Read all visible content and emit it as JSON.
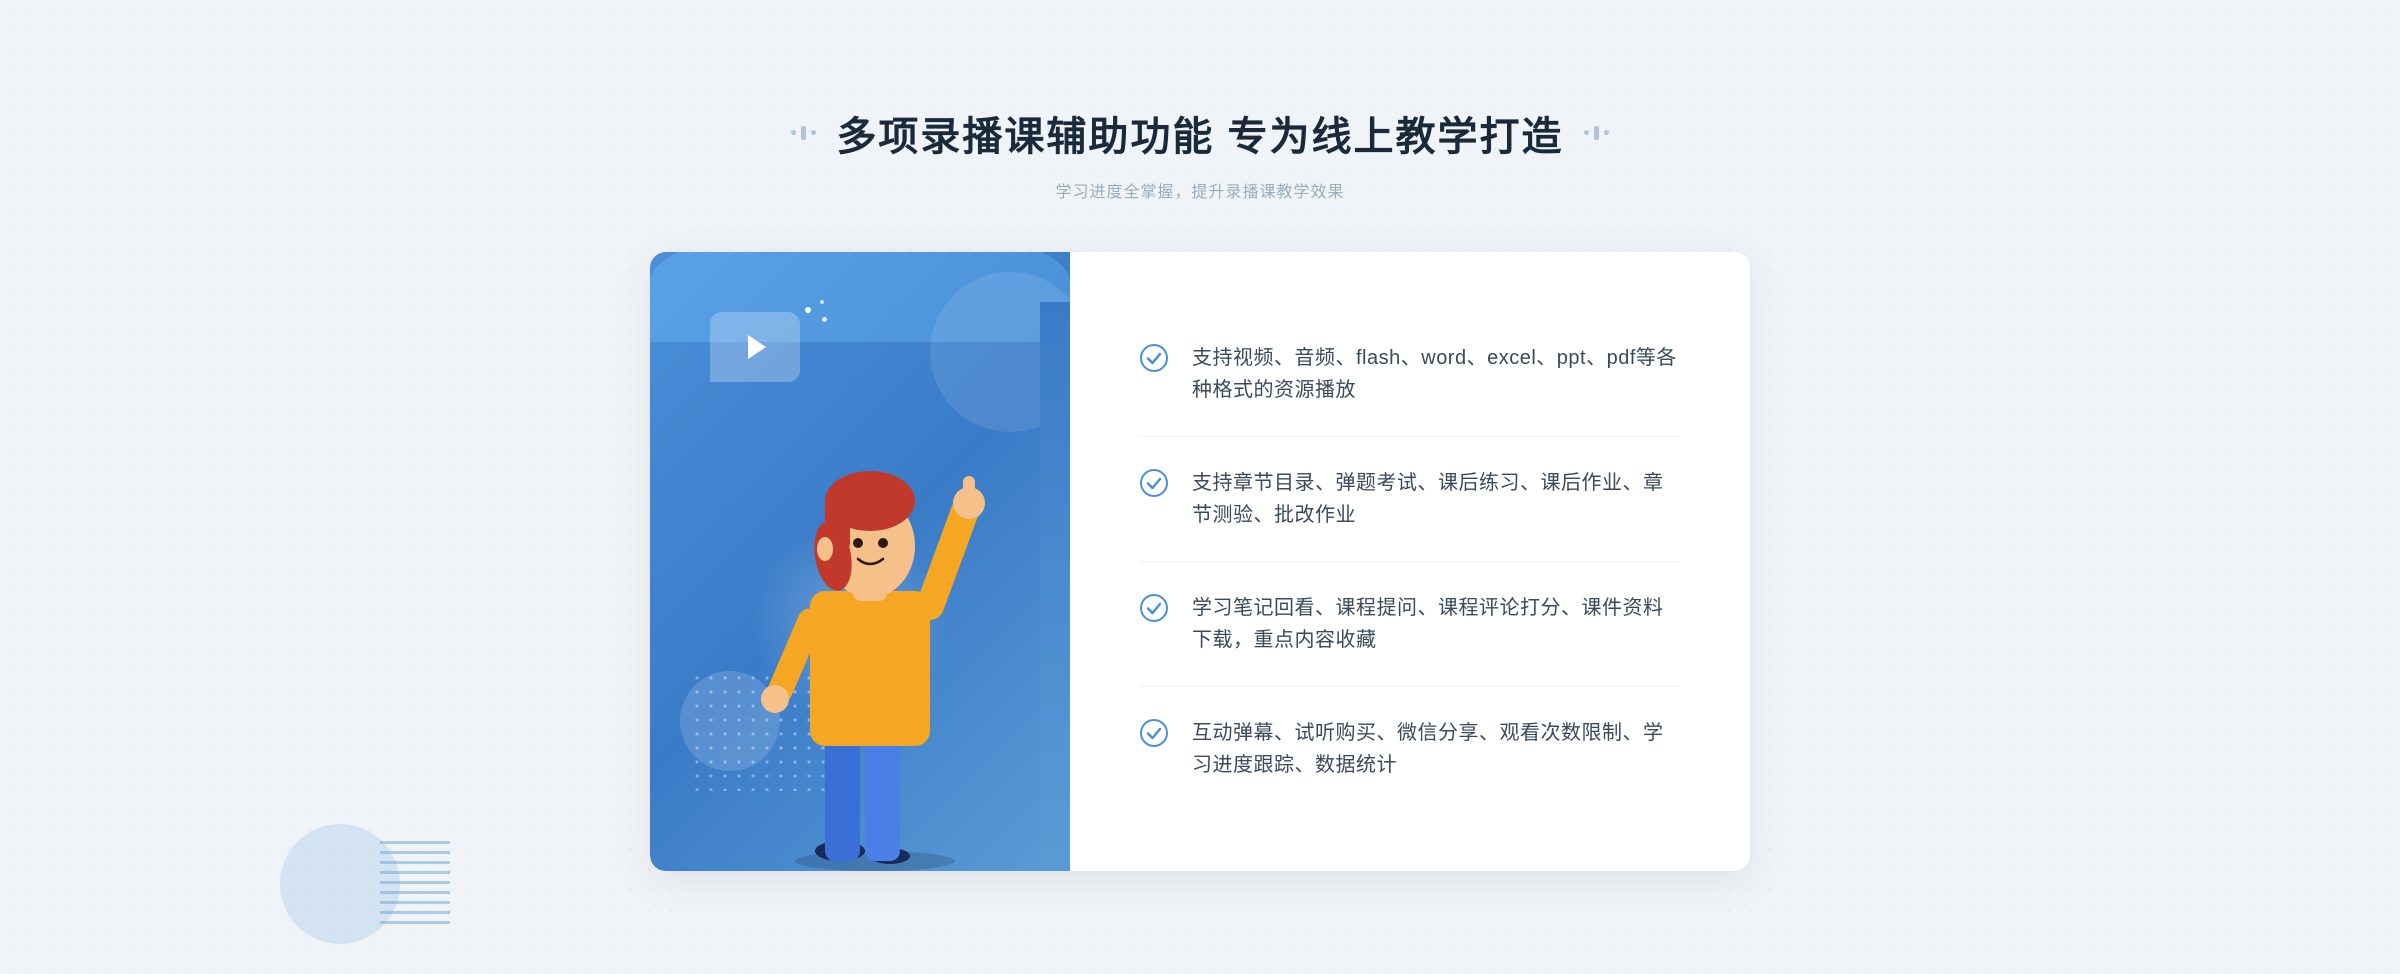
{
  "header": {
    "title": "多项录播课辅助功能 专为线上教学打造",
    "subtitle": "学习进度全掌握，提升录播课教学效果",
    "decoration_left": "❖",
    "decoration_right": "❖"
  },
  "features": [
    {
      "id": "feature-1",
      "text": "支持视频、音频、flash、word、excel、ppt、pdf等各种格式的资源播放"
    },
    {
      "id": "feature-2",
      "text": "支持章节目录、弹题考试、课后练习、课后作业、章节测验、批改作业"
    },
    {
      "id": "feature-3",
      "text": "学习笔记回看、课程提问、课程评论打分、课件资料下载，重点内容收藏"
    },
    {
      "id": "feature-4",
      "text": "互动弹幕、试听购买、微信分享、观看次数限制、学习进度跟踪、数据统计"
    }
  ],
  "colors": {
    "primary_blue": "#4a90d9",
    "title_color": "#1a2a3a",
    "text_color": "#3a4a5a",
    "subtitle_color": "#9aacbd",
    "check_color": "#4a90d9"
  }
}
